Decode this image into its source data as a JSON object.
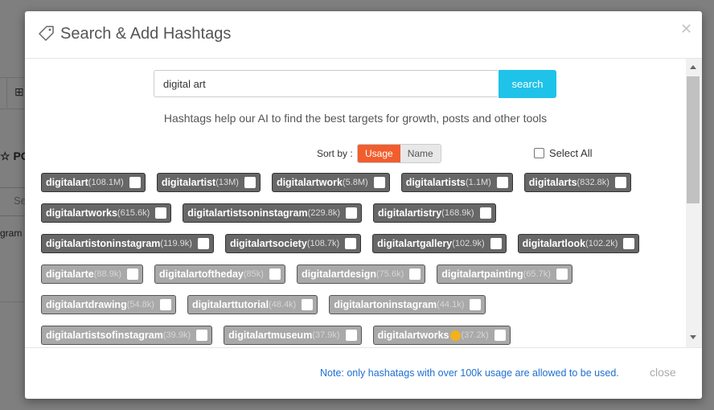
{
  "background": {
    "title": "PO",
    "input_placeholder": "Se",
    "text": "gram"
  },
  "modal": {
    "title": "Search & Add Hashtags",
    "search": {
      "value": "digital art",
      "button": "search"
    },
    "helper": "Hashtags help our AI to find the best targets for growth, posts and other tools",
    "sort_label": "Sort by :",
    "sort_options": [
      "Usage",
      "Name"
    ],
    "sort_active": "Usage",
    "select_all": "Select All",
    "hashtag_rows": [
      [
        {
          "tag": "digitalart",
          "count": "(108.1M)",
          "allowed": true
        },
        {
          "tag": "digitalartist",
          "count": "(13M)",
          "allowed": true
        },
        {
          "tag": "digitalartwork",
          "count": "(5.8M)",
          "allowed": true
        },
        {
          "tag": "digitalartists",
          "count": "(1.1M)",
          "allowed": true
        },
        {
          "tag": "digitalarts",
          "count": "(832.8k)",
          "allowed": true
        }
      ],
      [
        {
          "tag": "digitalartworks",
          "count": "(615.6k)",
          "allowed": true
        },
        {
          "tag": "digitalartistsoninstagram",
          "count": "(229.8k)",
          "allowed": true
        },
        {
          "tag": "digitalartistry",
          "count": "(168.9k)",
          "allowed": true
        }
      ],
      [
        {
          "tag": "digitalartistoninstagram",
          "count": "(119.9k)",
          "allowed": true
        },
        {
          "tag": "digitalartsociety",
          "count": "(108.7k)",
          "allowed": true
        },
        {
          "tag": "digitalartgallery",
          "count": "(102.9k)",
          "allowed": true
        },
        {
          "tag": "digitalartlook",
          "count": "(102.2k)",
          "allowed": true
        }
      ],
      [
        {
          "tag": "digitalarte",
          "count": "(88.9k)",
          "allowed": false
        },
        {
          "tag": "digitalartoftheday",
          "count": "(85k)",
          "allowed": false
        },
        {
          "tag": "digitalartdesign",
          "count": "(75.6k)",
          "allowed": false
        },
        {
          "tag": "digitalartpainting",
          "count": "(65.7k)",
          "allowed": false
        }
      ],
      [
        {
          "tag": "digitalartdrawing",
          "count": "(54.8k)",
          "allowed": false
        },
        {
          "tag": "digitalarttutorial",
          "count": "(48.4k)",
          "allowed": false
        },
        {
          "tag": "digitalartoninstagram",
          "count": "(44.1k)",
          "allowed": false
        }
      ],
      [
        {
          "tag": "digitalartistsofinstagram",
          "count": "(39.9k)",
          "allowed": false
        },
        {
          "tag": "digitalartmuseum",
          "count": "(37.9k)",
          "allowed": false
        },
        {
          "tag": "digitalartworks",
          "count": "(37.2k)",
          "allowed": false,
          "emoji": "palette-emoji"
        }
      ]
    ],
    "note": "Note: only hashatags with over 100k usage are allowed to be used.",
    "close": "close"
  },
  "colors": {
    "accent": "#1fc2e8",
    "sort_active": "#f05e2e",
    "chip_allowed": "#676767",
    "chip_low": "#a9a9a9",
    "note": "#1f6fd1"
  }
}
